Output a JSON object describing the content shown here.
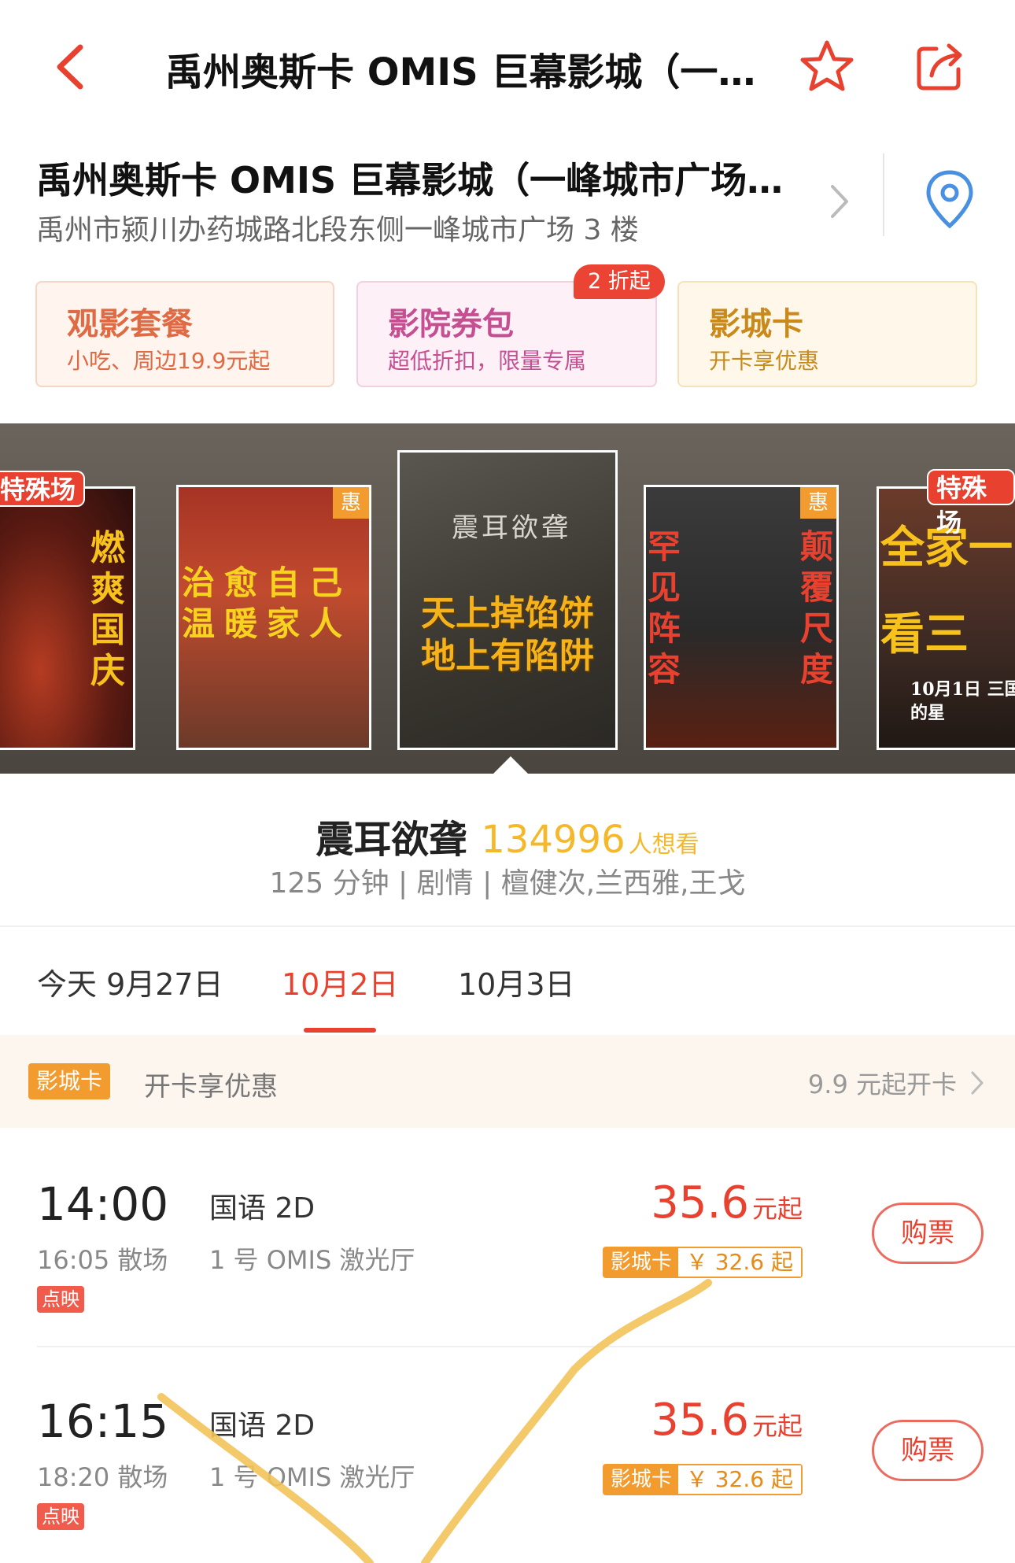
{
  "nav": {
    "title": "禹州奥斯卡 OMIS 巨幕影城（一…",
    "back_icon": "chevron-left-icon",
    "favorite_icon": "star-icon",
    "share_icon": "share-icon",
    "accent_color": "#e8412f"
  },
  "cinema": {
    "name": "禹州奥斯卡 OMIS 巨幕影城（一峰城市广场…",
    "address": "禹州市颍川办药城路北段东侧一峰城市广场 3 楼",
    "location_icon": "location-pin-icon"
  },
  "promos": [
    {
      "title": "观影套餐",
      "subtitle": "小吃、周边19.9元起"
    },
    {
      "title": "影院券包",
      "subtitle": "超低折扣，限量专属",
      "badge": "2 折起"
    },
    {
      "title": "影城卡",
      "subtitle": "开卡享优惠"
    }
  ],
  "posters": [
    {
      "tag": "特殊场",
      "text": "燃爽国庆"
    },
    {
      "badge": "惠",
      "text": "治愈自己 温暖家人"
    },
    {
      "text_small": "震耳欲聋",
      "text": "天上掉馅饼 地上有陷阱"
    },
    {
      "badge": "惠",
      "text_left": "罕见阵容",
      "text_right": "颠覆尺度"
    },
    {
      "tag": "特殊场",
      "text": "全家一 看三",
      "text_small": "10月1日 三国的星"
    }
  ],
  "movie": {
    "title": "震耳欲聋",
    "want_count": "134996",
    "want_label": "人想看",
    "meta": "125 分钟 | 剧情 | 檀健次,兰西雅,王戈"
  },
  "dates": [
    {
      "label": "今天 9月27日",
      "active": false
    },
    {
      "label": "10月2日",
      "active": true
    },
    {
      "label": "10月3日",
      "active": false
    }
  ],
  "card_strip": {
    "badge": "影城卡",
    "text": "开卡享优惠",
    "right_text": "9.9 元起开卡"
  },
  "showtimes": [
    {
      "time": "14:00",
      "end": "16:05 散场",
      "tag": "点映",
      "lang": "国语 2D",
      "hall": "1 号 OMIS 激光厅",
      "price": "35.6",
      "price_unit": "元起",
      "card_label": "影城卡",
      "card_price": "￥ 32.6 起",
      "buy_label": "购票"
    },
    {
      "time": "16:15",
      "end": "18:20 散场",
      "tag": "点映",
      "lang": "国语 2D",
      "hall": "1 号 OMIS 激光厅",
      "price": "35.6",
      "price_unit": "元起",
      "card_label": "影城卡",
      "card_price": "￥ 32.6 起",
      "buy_label": "购票"
    }
  ]
}
